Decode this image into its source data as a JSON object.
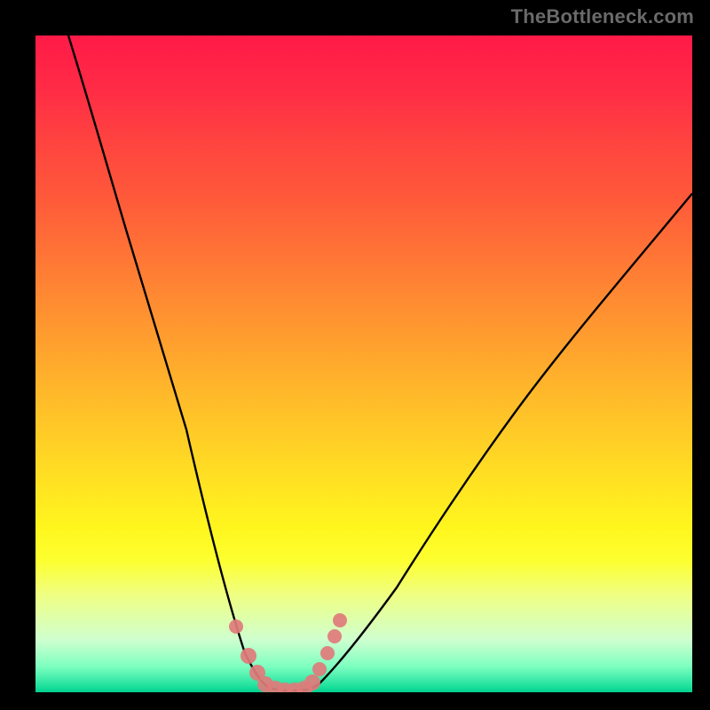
{
  "watermark": {
    "text": "TheBottleneck.com"
  },
  "chart_data": {
    "type": "line",
    "title": "",
    "xlabel": "",
    "ylabel": "",
    "xlim": [
      0,
      100
    ],
    "ylim": [
      0,
      100
    ],
    "grid": false,
    "series": [
      {
        "name": "left-curve",
        "x": [
          5,
          8,
          11,
          14,
          17,
          20,
          23,
          25,
          27,
          29,
          30.5,
          32,
          33.5,
          35
        ],
        "y": [
          100,
          90,
          80,
          70,
          60,
          50,
          40,
          32,
          24,
          16,
          10,
          6,
          3,
          1
        ],
        "stroke": "#000000"
      },
      {
        "name": "valley-floor",
        "x": [
          35,
          37,
          39,
          41,
          43
        ],
        "y": [
          1,
          0.3,
          0.2,
          0.4,
          1.2
        ],
        "stroke": "#000000"
      },
      {
        "name": "right-curve",
        "x": [
          43,
          46,
          50,
          55,
          60,
          66,
          73,
          81,
          90,
          100
        ],
        "y": [
          1.2,
          4,
          9,
          16,
          24,
          33,
          43,
          54,
          65,
          76
        ],
        "stroke": "#000000"
      }
    ],
    "markers": [
      {
        "name": "marker-dots",
        "color": "#e07b7b",
        "points_xy": [
          [
            30.5,
            10
          ],
          [
            32.5,
            5.5
          ],
          [
            33.8,
            3
          ],
          [
            35,
            1.2
          ],
          [
            36.5,
            0.5
          ],
          [
            38,
            0.3
          ],
          [
            39.5,
            0.3
          ],
          [
            41,
            0.5
          ],
          [
            42.2,
            1.5
          ],
          [
            43.3,
            3.5
          ],
          [
            44.5,
            6
          ],
          [
            45.5,
            8.5
          ],
          [
            46.3,
            11
          ]
        ]
      }
    ],
    "background": {
      "type": "vertical-gradient",
      "stops": [
        {
          "pos": 0,
          "color": "#ff1a47"
        },
        {
          "pos": 50,
          "color": "#ffba2a"
        },
        {
          "pos": 80,
          "color": "#fdff30"
        },
        {
          "pos": 100,
          "color": "#00d18e"
        }
      ]
    }
  }
}
